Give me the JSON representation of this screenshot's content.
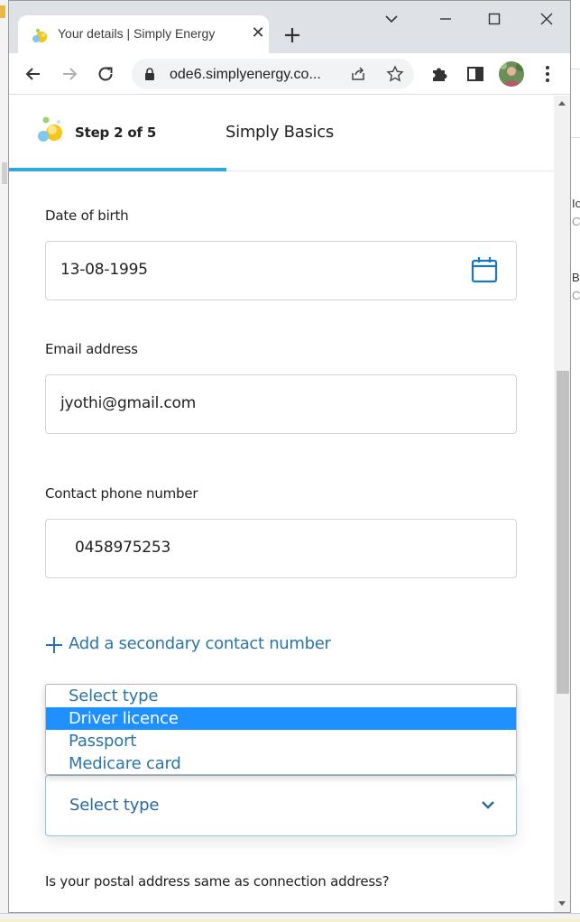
{
  "browser": {
    "tab_title": "Your details | Simply Energy",
    "close_symbol": "✕",
    "url": "ode6.simplyenergy.co..."
  },
  "desktop_right": {
    "fragments": [
      "Io",
      "C",
      "B:",
      "C"
    ]
  },
  "page": {
    "step_label": "Step 2 of 5",
    "step_name": "Simply Basics",
    "dob": {
      "label": "Date of birth",
      "value": "13-08-1995"
    },
    "email": {
      "label": "Email address",
      "value": "jyothi@gmail.com"
    },
    "phone": {
      "label": "Contact phone number",
      "value": "0458975253"
    },
    "add_secondary_label": "Add a secondary contact number",
    "id_select": {
      "value": "Select type",
      "options": [
        "Select type",
        "Driver licence",
        "Passport",
        "Medicare card"
      ],
      "highlighted_option": "Driver licence"
    },
    "postal_question": "Is your postal address same as connection address?"
  },
  "colors": {
    "accent": "#2fa8e0",
    "link": "#2a74a8",
    "highlight": "#1e90ff",
    "chrome_frame": "#dee1e6"
  }
}
